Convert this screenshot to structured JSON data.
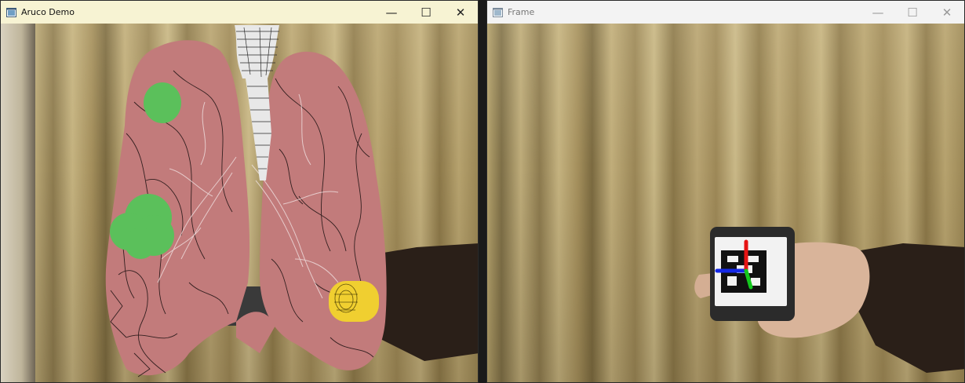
{
  "windows": {
    "aruco": {
      "title": "Aruco Demo",
      "controls": {
        "minimize": "—",
        "maximize": "☐",
        "close": "✕"
      }
    },
    "frame": {
      "title": "Frame",
      "controls": {
        "minimize": "—",
        "maximize": "☐",
        "close": "✕"
      }
    }
  },
  "icons": {
    "app": "opencv-window-icon",
    "axis_colors": {
      "x": "#1428e6",
      "y": "#e61414",
      "z": "#14c81e"
    }
  },
  "overlay_colors": {
    "lung": "#c27b7b",
    "lung_shadow": "#1a0f0f",
    "trachea": "#e8e8e8",
    "nodule_green": "#5bc05b",
    "nodule_yellow": "#f0cf30"
  }
}
